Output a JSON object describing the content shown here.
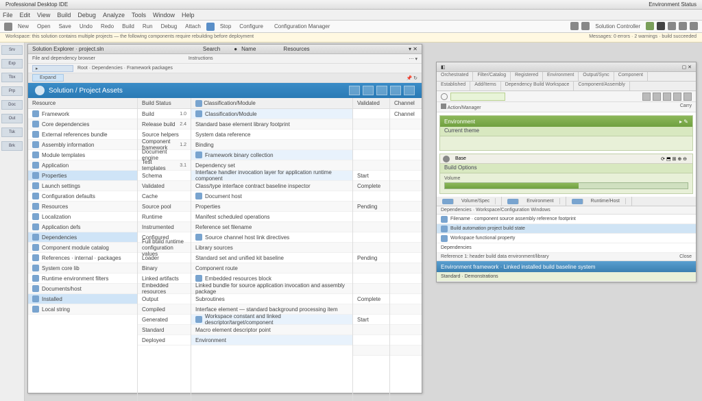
{
  "app": {
    "title": "Professional Desktop IDE",
    "right_title": "Environment Status"
  },
  "menu": [
    "File",
    "Edit",
    "View",
    "Build",
    "Debug",
    "Analyze",
    "Tools",
    "Window",
    "Help"
  ],
  "toolbar": {
    "items": [
      "New",
      "Open",
      "Save",
      "Undo",
      "Redo",
      "Build",
      "Run",
      "Debug",
      "Attach",
      "Stop",
      "Configure"
    ],
    "config_label": "Configuration Manager",
    "right_label": "Solution Controller"
  },
  "notice": {
    "left": "Workspace: this solution contains multiple projects — the following components require rebuilding before deployment",
    "right": "Messages: 0 errors · 2 warnings · build succeeded"
  },
  "leftrail": [
    "Srv",
    "Exp",
    "Tbx",
    "Prp",
    "Doc",
    "Out",
    "Tsk",
    "Brk"
  ],
  "leftwin": {
    "title": "Solution Explorer · project.sln",
    "search": "Search",
    "tabs": [
      "Name",
      "Resources"
    ],
    "sub1": "File and dependency browser",
    "sub2": "Instructions",
    "crumb": "Root · Dependencies · Framework packages",
    "tree_label": "Expand",
    "bluetitle": "Solution / Project Assets",
    "cols": [
      "Resource",
      "Build Status",
      "Classification/Module",
      "Validated",
      "Channel"
    ],
    "rows_a": [
      {
        "n": "Framework",
        "v": ""
      },
      {
        "n": "Core dependencies",
        "v": ""
      },
      {
        "n": "External references bundle",
        "v": ""
      },
      {
        "n": "Assembly information",
        "v": ""
      },
      {
        "n": "Module templates",
        "v": ""
      },
      {
        "n": "Application",
        "v": ""
      },
      {
        "n": "Properties",
        "v": ""
      },
      {
        "n": "Launch settings",
        "v": ""
      },
      {
        "n": "Configuration defaults",
        "v": ""
      },
      {
        "n": "Resources",
        "v": ""
      },
      {
        "n": "Localization",
        "v": ""
      },
      {
        "n": "Application defs",
        "v": ""
      },
      {
        "n": "Dependencies",
        "v": ""
      },
      {
        "n": "Component module catalog",
        "v": ""
      },
      {
        "n": "References · internal · packages",
        "v": ""
      },
      {
        "n": "System core lib",
        "v": ""
      },
      {
        "n": "Runtime environment filters",
        "v": ""
      },
      {
        "n": "Documents/host",
        "v": ""
      },
      {
        "n": "Installed",
        "v": ""
      },
      {
        "n": "Local string",
        "v": ""
      }
    ],
    "rows_b": [
      {
        "n": "Build"
      },
      {
        "n": "Release build"
      },
      {
        "n": "Source helpers"
      },
      {
        "n": "Component framework"
      },
      {
        "n": "Document engine"
      },
      {
        "n": "Test templates"
      },
      {
        "n": "Schema"
      },
      {
        "n": "Validated"
      },
      {
        "n": "Cache"
      },
      {
        "n": "Source pool"
      },
      {
        "n": "Runtime"
      },
      {
        "n": "Instrumented"
      },
      {
        "n": "Configured"
      },
      {
        "n": "Full build runtime configuration values"
      },
      {
        "n": "Loader"
      },
      {
        "n": "Binary"
      },
      {
        "n": "Linked artifacts"
      },
      {
        "n": "Embedded resources"
      },
      {
        "n": "Output"
      },
      {
        "n": "Compiled"
      },
      {
        "n": "Generated"
      },
      {
        "n": "Standard"
      },
      {
        "n": "Deployed"
      }
    ],
    "vals_b": [
      "1.0",
      "2.4",
      "",
      "1.2",
      "",
      "3.1",
      "",
      "",
      "",
      "",
      "",
      "",
      "",
      "",
      "",
      "",
      "",
      "",
      "",
      "",
      "",
      "",
      ""
    ],
    "rows_c": [
      "Classification/Module",
      "Standard base element library footprint",
      "System data reference",
      "Binding",
      "Framework binary collection",
      "Dependency set",
      "Interface handler invocation layer for application runtime component",
      "Class/type interface contract baseline inspector",
      "Document host",
      "Properties",
      "Manifest scheduled operations",
      "Reference set filename",
      "Source channel host link directives",
      "Library sources",
      "Standard set and unified kit baseline",
      "Component route",
      "Embedded resources block",
      "Linked bundle for source application invocation and assembly package",
      "Subroutines",
      "Interface element — standard background processing item",
      "Workspace constant and linked descriptor/target/component",
      "Macro element descriptor point",
      "Environment"
    ],
    "rows_d": [
      "",
      "",
      "",
      "",
      "",
      "",
      "Start",
      "Complete",
      "",
      "Pending",
      "",
      "",
      "",
      "",
      "Pending",
      "",
      "",
      "",
      "Complete",
      "",
      "Start",
      "",
      "",
      ""
    ],
    "rows_e": [
      "Channel",
      "",
      "",
      "",
      "",
      "",
      "",
      "",
      "",
      "",
      "",
      "",
      "",
      "",
      "",
      "",
      "",
      "",
      "",
      "",
      "",
      "",
      "",
      ""
    ]
  },
  "right": {
    "tabs1": [
      "Orchestrated",
      "Filter/Catalog",
      "Registered",
      "Environment",
      "Output/Sync",
      "Component"
    ],
    "tabs2": [
      "Established",
      "Add/Items",
      "Dependency Build Workspace",
      "Component/Assembly"
    ],
    "panel_title": "Action/Manager",
    "search_placeholder": "",
    "green1": {
      "title": "Environment",
      "sub": "Current theme",
      "body": ""
    },
    "green2": {
      "sub": "Build Options",
      "body": "Volume",
      "hint": "Base"
    },
    "midtabs": [
      "Volume/Spec",
      "Environment",
      "Runtime/Host"
    ],
    "section": "Dependencies · Workspace/Configuration Windows",
    "items": [
      "Filename · component source assembly reference footprint",
      "Build automation project build state",
      "Workspace functional property",
      "Dependencies"
    ],
    "footer_label": "Reference 1: header build data environment/library",
    "blue_title": "Environment framework · Linked installed build baseline system",
    "blue_items": [
      "Standard · Demonstrations"
    ],
    "corner": "Close",
    "collapse": "Carry"
  }
}
